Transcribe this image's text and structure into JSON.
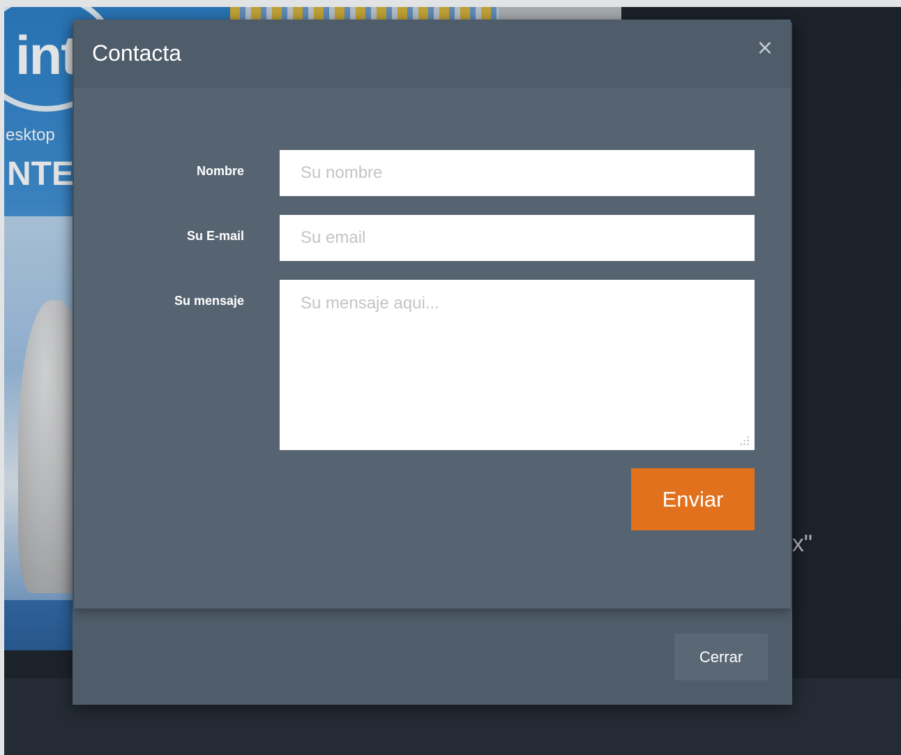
{
  "background": {
    "logo_text": "int",
    "desktop_text": "esktop",
    "inte_text": "NTE",
    "quote_fragment": "ox\""
  },
  "modal": {
    "title": "Contacta",
    "close_symbol": "×",
    "fields": {
      "name": {
        "label": "Nombre",
        "placeholder": "Su nombre",
        "value": ""
      },
      "email": {
        "label": "Su E-mail",
        "placeholder": "Su email",
        "value": ""
      },
      "message": {
        "label": "Su mensaje",
        "placeholder": "Su mensaje aqui...",
        "value": ""
      }
    },
    "send_label": "Enviar",
    "close_label": "Cerrar"
  },
  "colors": {
    "accent": "#e2711d",
    "modal_body": "#566472",
    "modal_header": "#4f5c69",
    "page_dark": "#1e242c"
  }
}
